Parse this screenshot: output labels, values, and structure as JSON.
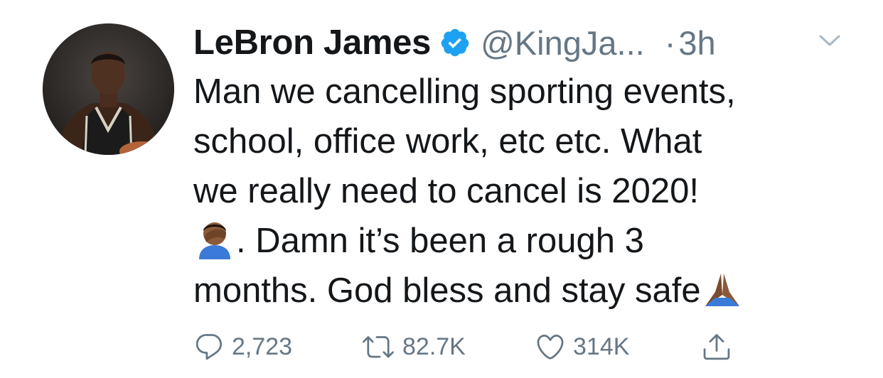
{
  "tweet": {
    "author": {
      "name": "LeBron James",
      "handle": "@KingJa...",
      "verified": true,
      "verified_color": "#1da1f2",
      "avatar_icon": "basketball-player-avatar"
    },
    "dot": "·",
    "time": "3h",
    "text_lines": [
      "Man we cancelling sporting events,",
      "school, office work, etc etc. What",
      "we really need to cancel is 2020!",
      ". Damn it’s been a rough 3",
      "months. God bless and stay safe"
    ],
    "emojis": {
      "facepalm": "man-facepalming-emoji",
      "pray": "folded-hands-emoji"
    },
    "actions": {
      "replies": "2,723",
      "retweets": "82.7K",
      "likes": "314K"
    },
    "colors": {
      "text": "#14171a",
      "muted": "#657786",
      "accent": "#1da1f2"
    }
  }
}
